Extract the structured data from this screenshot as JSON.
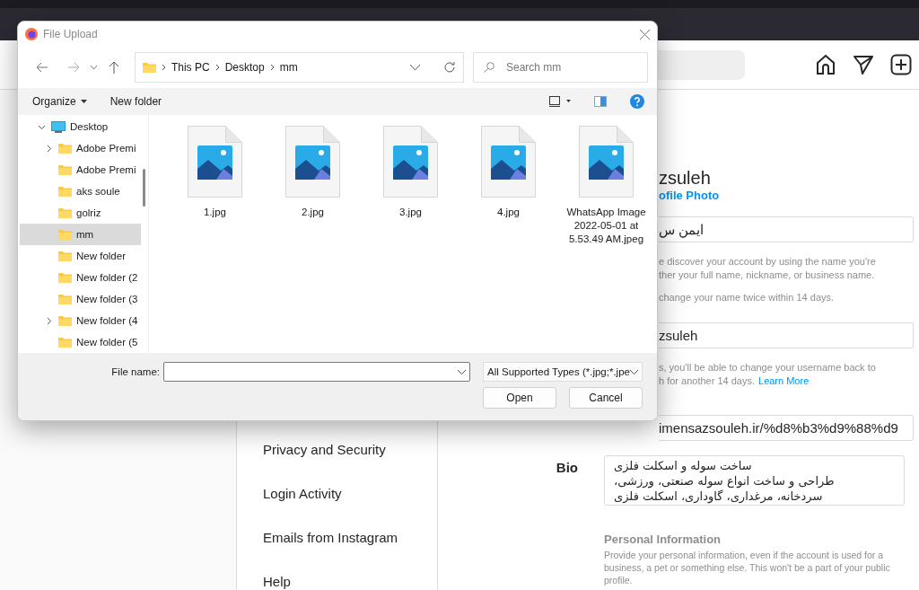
{
  "page": {
    "nav_items": [
      {
        "label": "Privacy and Security"
      },
      {
        "label": "Login Activity"
      },
      {
        "label": "Emails from Instagram"
      },
      {
        "label": "Help"
      }
    ],
    "username_heading": "zsuleh",
    "change_photo": "ofile Photo",
    "name_field": {
      "value": "ایمن س"
    },
    "name_help": [
      "e discover your account by using the name you're",
      "ther your full name, nickname, or business name."
    ],
    "name_note": "change your name twice within 14 days.",
    "username_field": {
      "value": "zsuleh"
    },
    "username_help": [
      "s, you'll be able to change your username back to",
      "h for another 14 days."
    ],
    "learn_more": "Learn More",
    "website_field": {
      "value": "imensazsouleh.ir/%d8%b3%d9%88%d9"
    },
    "bio_label": "Bio",
    "bio": [
      "ساخت سوله و اسکلت فلزی",
      "طراحی و ساخت انواع سوله صنعتی، ورزشی،",
      "سردخانه، مرغداری، گاوداری، اسکلت فلزی"
    ],
    "personal_title": "Personal Information",
    "personal_text": "Provide your personal information, even if the account is used for a business, a pet or something else. This won't be a part of your public profile."
  },
  "dialog": {
    "title": "File Upload",
    "breadcrumb": [
      "This PC",
      "Desktop",
      "mm"
    ],
    "search": {
      "placeholder": "Search mm"
    },
    "toolbar": [
      "Organize",
      "New folder"
    ],
    "tree": [
      {
        "label": "Desktop",
        "kind": "expanded",
        "selected": false,
        "children": [
          {
            "label": "Adobe Premi",
            "kind": "collapsed",
            "selected": false
          },
          {
            "label": "Adobe Premi",
            "kind": "leaf",
            "selected": false
          },
          {
            "label": "aks soule",
            "kind": "leaf",
            "selected": false
          },
          {
            "label": "golriz",
            "kind": "leaf",
            "selected": false
          },
          {
            "label": "mm",
            "kind": "leaf",
            "selected": true
          },
          {
            "label": "New folder",
            "kind": "leaf",
            "selected": false
          },
          {
            "label": "New folder (2",
            "kind": "leaf",
            "selected": false
          },
          {
            "label": "New folder (3",
            "kind": "leaf",
            "selected": false
          },
          {
            "label": "New folder (4",
            "kind": "collapsed",
            "selected": false
          },
          {
            "label": "New folder (5",
            "kind": "leaf",
            "selected": false
          }
        ]
      }
    ],
    "files": [
      {
        "name": "1.jpg"
      },
      {
        "name": "2.jpg"
      },
      {
        "name": "3.jpg"
      },
      {
        "name": "4.jpg"
      },
      {
        "name": "WhatsApp Image 2022-05-01 at 5.53.49 AM.jpeg"
      }
    ],
    "file_name_label": "File name:",
    "file_type": "All Supported Types (*.jpg;*.jpe",
    "buttons": [
      "Open",
      "Cancel"
    ]
  }
}
